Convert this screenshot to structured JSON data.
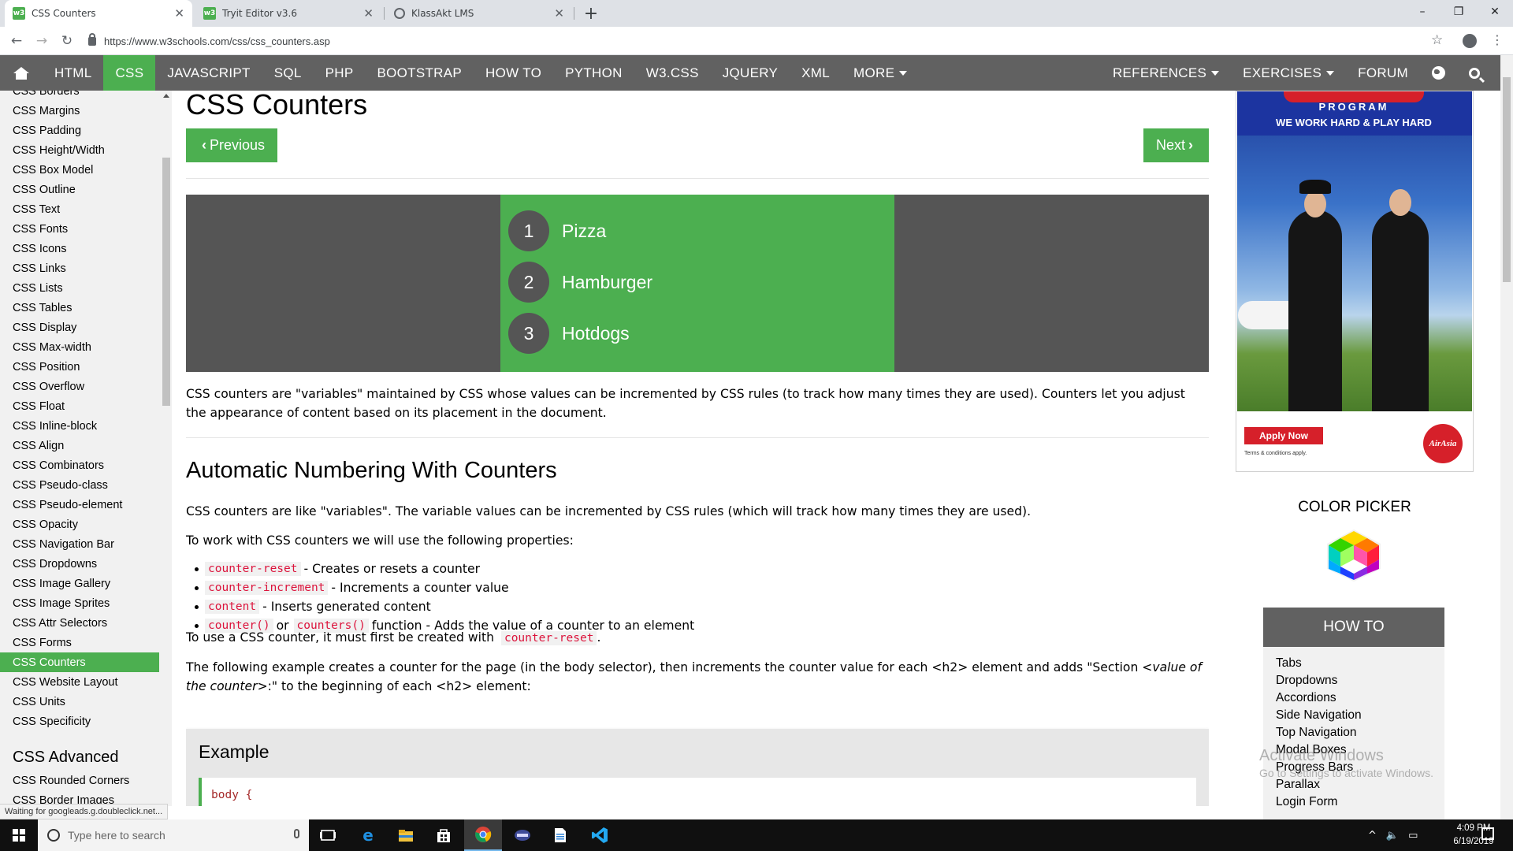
{
  "browser": {
    "tabs": [
      {
        "label": "CSS Counters",
        "favicon": "w3schools-icon",
        "active": true
      },
      {
        "label": "Tryit Editor v3.6",
        "favicon": "w3schools-icon",
        "active": false
      },
      {
        "label": "KlassAkt LMS",
        "favicon": "globe-icon",
        "active": false
      }
    ],
    "new_tab": "+",
    "window_controls": {
      "minimize": "–",
      "maximize": "❐",
      "close": "✕"
    },
    "url": "https://www.w3schools.com/css/css_counters.asp"
  },
  "topnav": {
    "left": [
      "HTML",
      "CSS",
      "JAVASCRIPT",
      "SQL",
      "PHP",
      "BOOTSTRAP",
      "HOW TO",
      "PYTHON",
      "W3.CSS",
      "JQUERY",
      "XML",
      "MORE"
    ],
    "active": "CSS",
    "right": [
      "REFERENCES",
      "EXERCISES",
      "FORUM"
    ],
    "colors": {
      "bar": "#616161",
      "active": "#4caf50"
    }
  },
  "sidebar": {
    "items": [
      "CSS Borders",
      "CSS Margins",
      "CSS Padding",
      "CSS Height/Width",
      "CSS Box Model",
      "CSS Outline",
      "CSS Text",
      "CSS Fonts",
      "CSS Icons",
      "CSS Links",
      "CSS Lists",
      "CSS Tables",
      "CSS Display",
      "CSS Max-width",
      "CSS Position",
      "CSS Overflow",
      "CSS Float",
      "CSS Inline-block",
      "CSS Align",
      "CSS Combinators",
      "CSS Pseudo-class",
      "CSS Pseudo-element",
      "CSS Opacity",
      "CSS Navigation Bar",
      "CSS Dropdowns",
      "CSS Image Gallery",
      "CSS Image Sprites",
      "CSS Attr Selectors",
      "CSS Forms",
      "CSS Counters",
      "CSS Website Layout",
      "CSS Units",
      "CSS Specificity"
    ],
    "active": "CSS Counters",
    "section2_title": "CSS Advanced",
    "section2_items": [
      "CSS Rounded Corners",
      "CSS Border Images"
    ]
  },
  "main": {
    "title": "CSS Counters",
    "prev_label": "Previous",
    "next_label": "Next",
    "demo_items": [
      {
        "num": "1",
        "text": "Pizza"
      },
      {
        "num": "2",
        "text": "Hamburger"
      },
      {
        "num": "3",
        "text": "Hotdogs"
      }
    ],
    "intro": "CSS counters are \"variables\" maintained by CSS whose values can be incremented by CSS rules (to track how many times they are used). Counters let you adjust the appearance of content based on its placement in the document.",
    "h2": "Automatic Numbering With Counters",
    "p1": "CSS counters are like \"variables\". The variable values can be incremented by CSS rules (which will track how many times they are used).",
    "p2": "To work with CSS counters we will use the following properties:",
    "bullets": [
      {
        "codes": [
          "counter-reset"
        ],
        "or": "",
        "text": "- Creates or resets a counter"
      },
      {
        "codes": [
          "counter-increment"
        ],
        "or": "",
        "text": "- Increments a counter value"
      },
      {
        "codes": [
          "content"
        ],
        "or": "",
        "text": "- Inserts generated content"
      },
      {
        "codes": [
          "counter()",
          "counters()"
        ],
        "or": "or",
        "text": "function - Adds the value of a counter to an element"
      }
    ],
    "p3_pre": "To use a CSS counter, it must first be created with",
    "p3_code": "counter-reset",
    "p3_post": ".",
    "p4_a": "The following example creates a counter for the page (in the body selector), then increments the counter value for each <h2> element and adds \"Section <",
    "p4_em": "value of the counter",
    "p4_b": ">:\" to the beginning of each <h2> element:",
    "example_title": "Example",
    "example_code": "body {"
  },
  "ad": {
    "program": "PROGRAM",
    "tagline": "WE WORK HARD & PLAY HARD",
    "apply": "Apply Now",
    "terms": "Terms & conditions apply.",
    "brand": "AirAsia"
  },
  "color_picker": {
    "title": "COLOR PICKER"
  },
  "howto": {
    "title": "HOW TO",
    "items": [
      "Tabs",
      "Dropdowns",
      "Accordions",
      "Side Navigation",
      "Top Navigation",
      "Modal Boxes",
      "Progress Bars",
      "Parallax",
      "Login Form"
    ]
  },
  "watermark": {
    "line1": "Activate Windows",
    "line2": "Go to Settings to activate Windows."
  },
  "status_text": "Waiting for googleads.g.doubleclick.net...",
  "taskbar": {
    "search_placeholder": "Type here to search",
    "time": "4:09 PM",
    "date": "6/19/2019"
  }
}
